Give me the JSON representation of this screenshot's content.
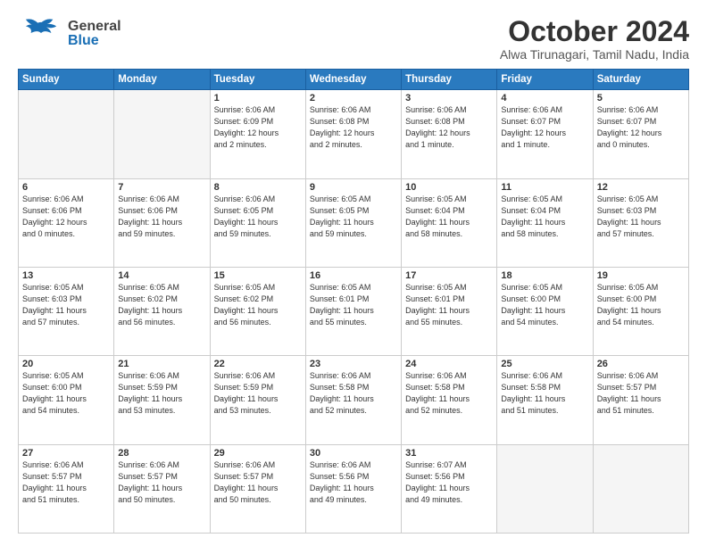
{
  "header": {
    "logo_general": "General",
    "logo_blue": "Blue",
    "title": "October 2024",
    "location": "Alwa Tirunagari, Tamil Nadu, India"
  },
  "days_of_week": [
    "Sunday",
    "Monday",
    "Tuesday",
    "Wednesday",
    "Thursday",
    "Friday",
    "Saturday"
  ],
  "weeks": [
    [
      {
        "day": "",
        "info": ""
      },
      {
        "day": "",
        "info": ""
      },
      {
        "day": "1",
        "info": "Sunrise: 6:06 AM\nSunset: 6:09 PM\nDaylight: 12 hours\nand 2 minutes."
      },
      {
        "day": "2",
        "info": "Sunrise: 6:06 AM\nSunset: 6:08 PM\nDaylight: 12 hours\nand 2 minutes."
      },
      {
        "day": "3",
        "info": "Sunrise: 6:06 AM\nSunset: 6:08 PM\nDaylight: 12 hours\nand 1 minute."
      },
      {
        "day": "4",
        "info": "Sunrise: 6:06 AM\nSunset: 6:07 PM\nDaylight: 12 hours\nand 1 minute."
      },
      {
        "day": "5",
        "info": "Sunrise: 6:06 AM\nSunset: 6:07 PM\nDaylight: 12 hours\nand 0 minutes."
      }
    ],
    [
      {
        "day": "6",
        "info": "Sunrise: 6:06 AM\nSunset: 6:06 PM\nDaylight: 12 hours\nand 0 minutes."
      },
      {
        "day": "7",
        "info": "Sunrise: 6:06 AM\nSunset: 6:06 PM\nDaylight: 11 hours\nand 59 minutes."
      },
      {
        "day": "8",
        "info": "Sunrise: 6:06 AM\nSunset: 6:05 PM\nDaylight: 11 hours\nand 59 minutes."
      },
      {
        "day": "9",
        "info": "Sunrise: 6:05 AM\nSunset: 6:05 PM\nDaylight: 11 hours\nand 59 minutes."
      },
      {
        "day": "10",
        "info": "Sunrise: 6:05 AM\nSunset: 6:04 PM\nDaylight: 11 hours\nand 58 minutes."
      },
      {
        "day": "11",
        "info": "Sunrise: 6:05 AM\nSunset: 6:04 PM\nDaylight: 11 hours\nand 58 minutes."
      },
      {
        "day": "12",
        "info": "Sunrise: 6:05 AM\nSunset: 6:03 PM\nDaylight: 11 hours\nand 57 minutes."
      }
    ],
    [
      {
        "day": "13",
        "info": "Sunrise: 6:05 AM\nSunset: 6:03 PM\nDaylight: 11 hours\nand 57 minutes."
      },
      {
        "day": "14",
        "info": "Sunrise: 6:05 AM\nSunset: 6:02 PM\nDaylight: 11 hours\nand 56 minutes."
      },
      {
        "day": "15",
        "info": "Sunrise: 6:05 AM\nSunset: 6:02 PM\nDaylight: 11 hours\nand 56 minutes."
      },
      {
        "day": "16",
        "info": "Sunrise: 6:05 AM\nSunset: 6:01 PM\nDaylight: 11 hours\nand 55 minutes."
      },
      {
        "day": "17",
        "info": "Sunrise: 6:05 AM\nSunset: 6:01 PM\nDaylight: 11 hours\nand 55 minutes."
      },
      {
        "day": "18",
        "info": "Sunrise: 6:05 AM\nSunset: 6:00 PM\nDaylight: 11 hours\nand 54 minutes."
      },
      {
        "day": "19",
        "info": "Sunrise: 6:05 AM\nSunset: 6:00 PM\nDaylight: 11 hours\nand 54 minutes."
      }
    ],
    [
      {
        "day": "20",
        "info": "Sunrise: 6:05 AM\nSunset: 6:00 PM\nDaylight: 11 hours\nand 54 minutes."
      },
      {
        "day": "21",
        "info": "Sunrise: 6:06 AM\nSunset: 5:59 PM\nDaylight: 11 hours\nand 53 minutes."
      },
      {
        "day": "22",
        "info": "Sunrise: 6:06 AM\nSunset: 5:59 PM\nDaylight: 11 hours\nand 53 minutes."
      },
      {
        "day": "23",
        "info": "Sunrise: 6:06 AM\nSunset: 5:58 PM\nDaylight: 11 hours\nand 52 minutes."
      },
      {
        "day": "24",
        "info": "Sunrise: 6:06 AM\nSunset: 5:58 PM\nDaylight: 11 hours\nand 52 minutes."
      },
      {
        "day": "25",
        "info": "Sunrise: 6:06 AM\nSunset: 5:58 PM\nDaylight: 11 hours\nand 51 minutes."
      },
      {
        "day": "26",
        "info": "Sunrise: 6:06 AM\nSunset: 5:57 PM\nDaylight: 11 hours\nand 51 minutes."
      }
    ],
    [
      {
        "day": "27",
        "info": "Sunrise: 6:06 AM\nSunset: 5:57 PM\nDaylight: 11 hours\nand 51 minutes."
      },
      {
        "day": "28",
        "info": "Sunrise: 6:06 AM\nSunset: 5:57 PM\nDaylight: 11 hours\nand 50 minutes."
      },
      {
        "day": "29",
        "info": "Sunrise: 6:06 AM\nSunset: 5:57 PM\nDaylight: 11 hours\nand 50 minutes."
      },
      {
        "day": "30",
        "info": "Sunrise: 6:06 AM\nSunset: 5:56 PM\nDaylight: 11 hours\nand 49 minutes."
      },
      {
        "day": "31",
        "info": "Sunrise: 6:07 AM\nSunset: 5:56 PM\nDaylight: 11 hours\nand 49 minutes."
      },
      {
        "day": "",
        "info": ""
      },
      {
        "day": "",
        "info": ""
      }
    ]
  ]
}
